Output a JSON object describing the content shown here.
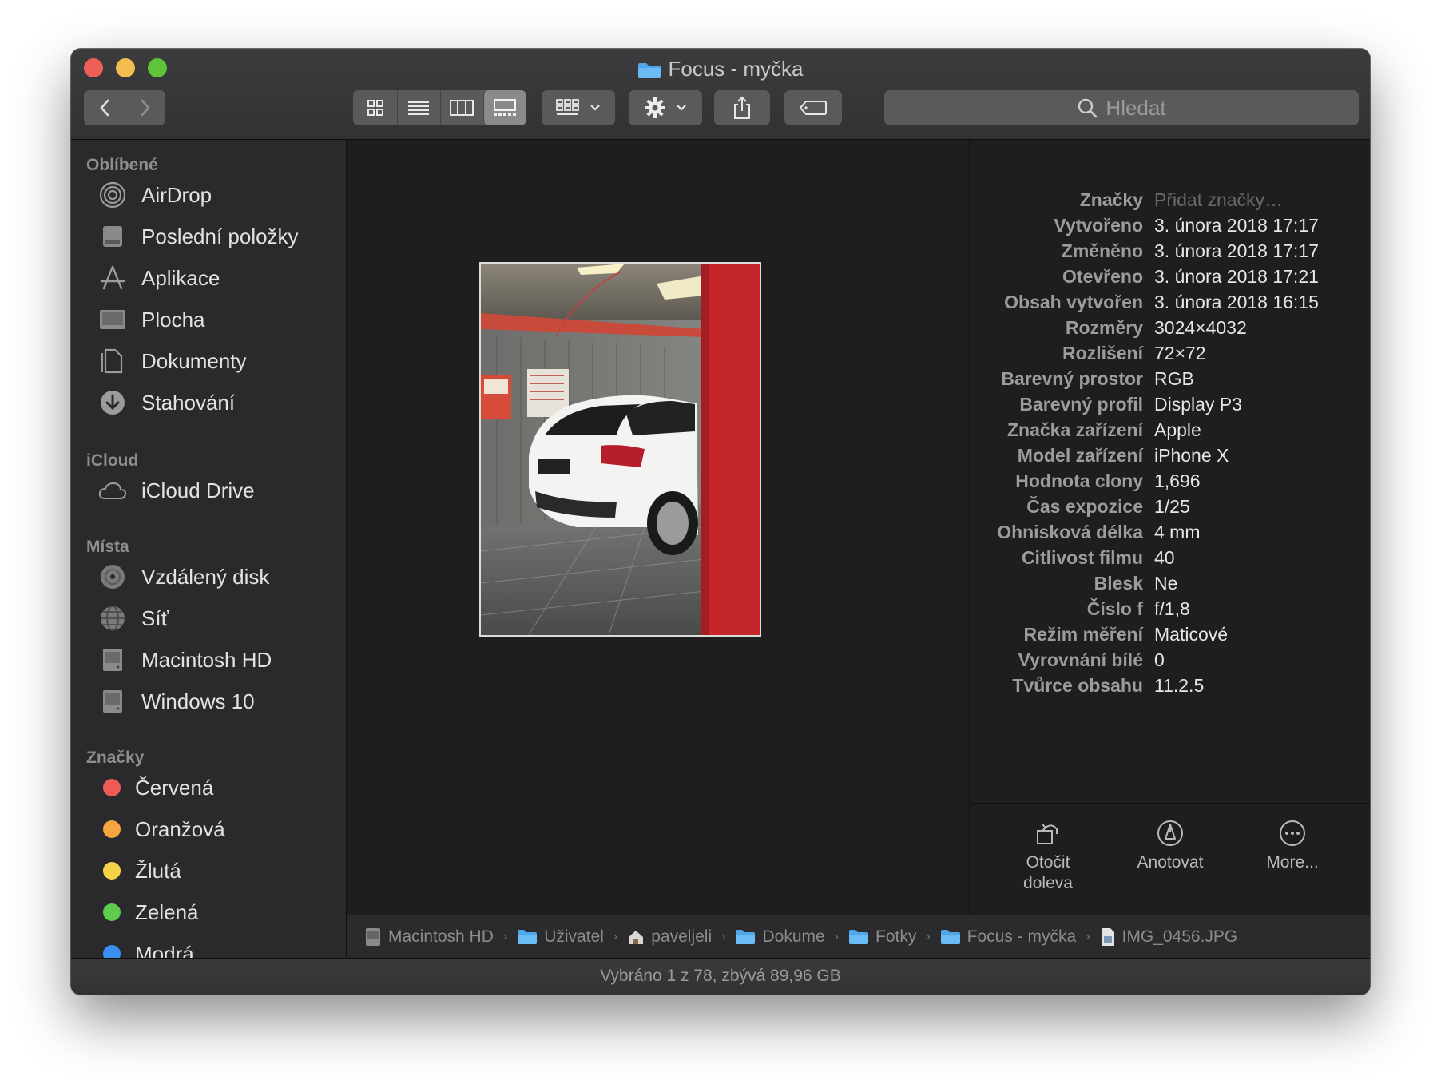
{
  "window": {
    "title": "Focus - myčka"
  },
  "toolbar": {
    "view_modes": [
      "icon-view",
      "list-view",
      "column-view",
      "gallery-view"
    ],
    "active_view": "gallery-view"
  },
  "search": {
    "placeholder": "Hledat"
  },
  "sidebar": {
    "favorites_header": "Oblíbené",
    "favorites": [
      {
        "label": "AirDrop",
        "icon": "airdrop-icon"
      },
      {
        "label": "Poslední položky",
        "icon": "recents-icon"
      },
      {
        "label": "Aplikace",
        "icon": "applications-icon"
      },
      {
        "label": "Plocha",
        "icon": "desktop-icon"
      },
      {
        "label": "Dokumenty",
        "icon": "documents-icon"
      },
      {
        "label": "Stahování",
        "icon": "downloads-icon"
      }
    ],
    "icloud_header": "iCloud",
    "icloud": [
      {
        "label": "iCloud Drive",
        "icon": "cloud-icon"
      }
    ],
    "locations_header": "Místa",
    "locations": [
      {
        "label": "Vzdálený disk",
        "icon": "remote-disc-icon"
      },
      {
        "label": "Síť",
        "icon": "network-icon"
      },
      {
        "label": "Macintosh HD",
        "icon": "hard-drive-icon"
      },
      {
        "label": "Windows 10",
        "icon": "hard-drive-icon"
      }
    ],
    "tags_header": "Značky",
    "tags": [
      {
        "label": "Červená",
        "color": "#ee5b57"
      },
      {
        "label": "Oranžová",
        "color": "#f5a640"
      },
      {
        "label": "Žlutá",
        "color": "#f6d249"
      },
      {
        "label": "Zelená",
        "color": "#5ecb4f"
      },
      {
        "label": "Modrá",
        "color": "#3b8ff0"
      }
    ]
  },
  "info": {
    "rows": [
      {
        "label": "Značky",
        "value": "Přidat značky…",
        "placeholder": true
      },
      {
        "label": "Vytvořeno",
        "value": "3. února 2018 17:17"
      },
      {
        "label": "Změněno",
        "value": "3. února 2018 17:17"
      },
      {
        "label": "Otevřeno",
        "value": "3. února 2018 17:21"
      },
      {
        "label": "Obsah vytvořen",
        "value": "3. února 2018 16:15"
      },
      {
        "label": "Rozměry",
        "value": "3024×4032"
      },
      {
        "label": "Rozlišení",
        "value": "72×72"
      },
      {
        "label": "Barevný prostor",
        "value": "RGB"
      },
      {
        "label": "Barevný profil",
        "value": "Display P3"
      },
      {
        "label": "Značka zařízení",
        "value": "Apple"
      },
      {
        "label": "Model zařízení",
        "value": "iPhone X"
      },
      {
        "label": "Hodnota clony",
        "value": "1,696"
      },
      {
        "label": "Čas expozice",
        "value": "1/25"
      },
      {
        "label": "Ohnisková délka",
        "value": "4 mm"
      },
      {
        "label": "Citlivost filmu",
        "value": "40"
      },
      {
        "label": "Blesk",
        "value": "Ne"
      },
      {
        "label": "Číslo f",
        "value": "f/1,8"
      },
      {
        "label": "Režim měření",
        "value": "Maticové"
      },
      {
        "label": "Vyrovnání bílé",
        "value": "0"
      },
      {
        "label": "Tvůrce obsahu",
        "value": "11.2.5"
      }
    ],
    "actions": {
      "rotate_line1": "Otočit",
      "rotate_line2": "doleva",
      "annotate": "Anotovat",
      "more": "More..."
    }
  },
  "pathbar": [
    {
      "label": "Macintosh HD",
      "icon": "hard-drive-icon"
    },
    {
      "label": "Uživatel",
      "icon": "folder-icon"
    },
    {
      "label": "paveljeli",
      "icon": "home-icon"
    },
    {
      "label": "Dokume",
      "icon": "folder-icon"
    },
    {
      "label": "Fotky",
      "icon": "folder-icon"
    },
    {
      "label": "Focus - myčka",
      "icon": "folder-icon"
    },
    {
      "label": "IMG_0456.JPG",
      "icon": "file-icon"
    }
  ],
  "status": {
    "text": "Vybráno 1 z 78, zbývá 89,96 GB"
  }
}
